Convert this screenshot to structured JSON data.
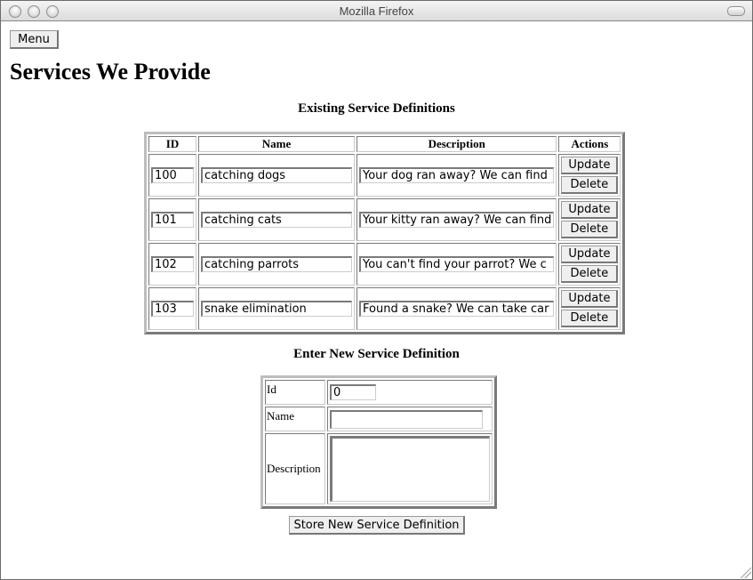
{
  "window": {
    "title": "Mozilla Firefox"
  },
  "toolbar": {
    "menu_label": "Menu"
  },
  "page": {
    "title": "Services We Provide"
  },
  "existing": {
    "caption": "Existing Service Definitions",
    "headers": {
      "id": "ID",
      "name": "Name",
      "description": "Description",
      "actions": "Actions"
    },
    "rows": [
      {
        "id": "100",
        "name": "catching dogs",
        "description": "Your dog ran away?  We can find",
        "update": "Update",
        "delete": "Delete"
      },
      {
        "id": "101",
        "name": "catching cats",
        "description": "Your kitty ran away? We can find",
        "update": "Update",
        "delete": "Delete"
      },
      {
        "id": "102",
        "name": "catching parrots",
        "description": "You can't find your parrot?  We c",
        "update": "Update",
        "delete": "Delete"
      },
      {
        "id": "103",
        "name": "snake elimination",
        "description": "Found a snake?  We can take car",
        "update": "Update",
        "delete": "Delete"
      }
    ]
  },
  "new_service": {
    "caption": "Enter New Service Definition",
    "id_label": "Id",
    "id_value": "0",
    "name_label": "Name",
    "name_value": "",
    "description_label": "Description",
    "description_value": "",
    "store_label": "Store New Service Definition"
  }
}
